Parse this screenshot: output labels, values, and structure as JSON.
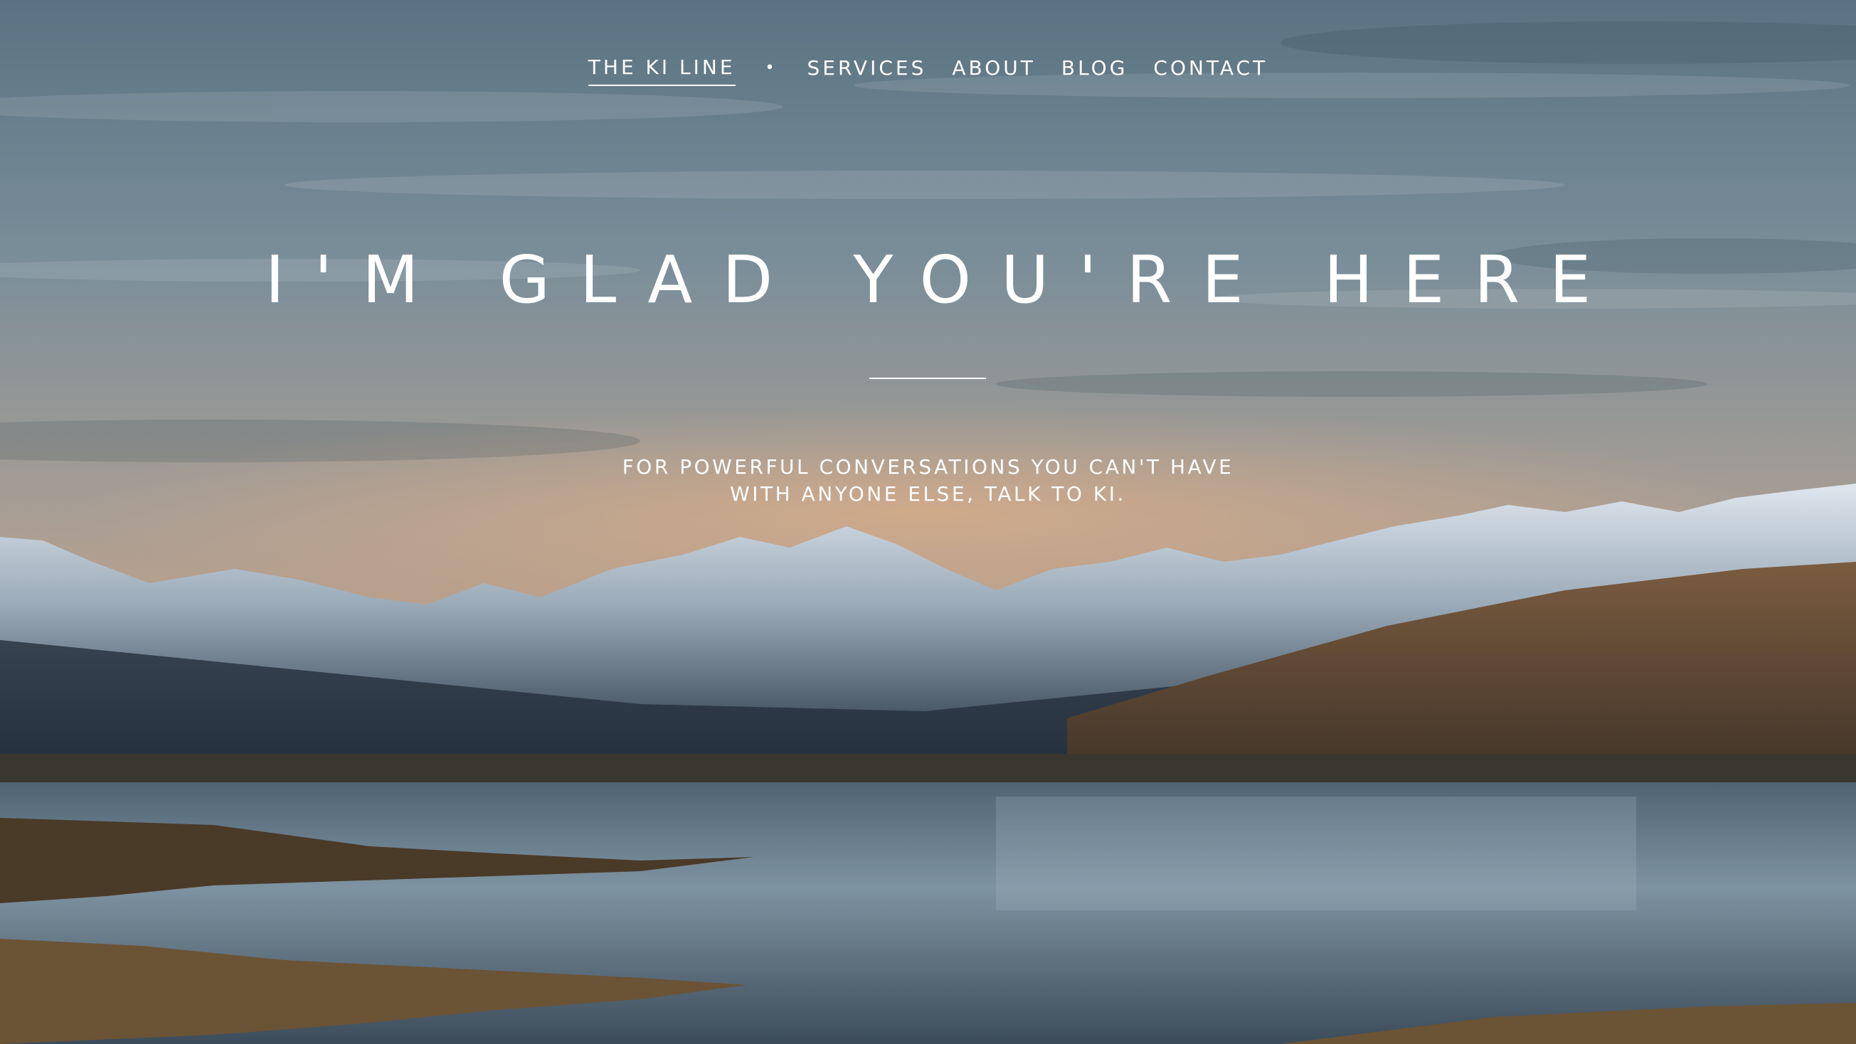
{
  "nav": {
    "items": [
      {
        "label": "THE KI LINE",
        "active": true
      },
      {
        "label": "SERVICES",
        "active": false
      },
      {
        "label": "ABOUT",
        "active": false
      },
      {
        "label": "BLOG",
        "active": false
      },
      {
        "label": "CONTACT",
        "active": false
      }
    ],
    "separator": "•"
  },
  "hero": {
    "title": "I'M GLAD YOU'RE HERE",
    "subtitle_line1": "FOR POWERFUL CONVERSATIONS YOU CAN'T HAVE",
    "subtitle_line2": "WITH ANYONE ELSE, TALK TO KI."
  },
  "background": {
    "description_colors": {
      "sky_top": "#5f7686",
      "sky_glow": "#d9a680",
      "snow": "#dfe6ee",
      "hills": "#7a5a3c",
      "lake": "#6d8596"
    }
  }
}
